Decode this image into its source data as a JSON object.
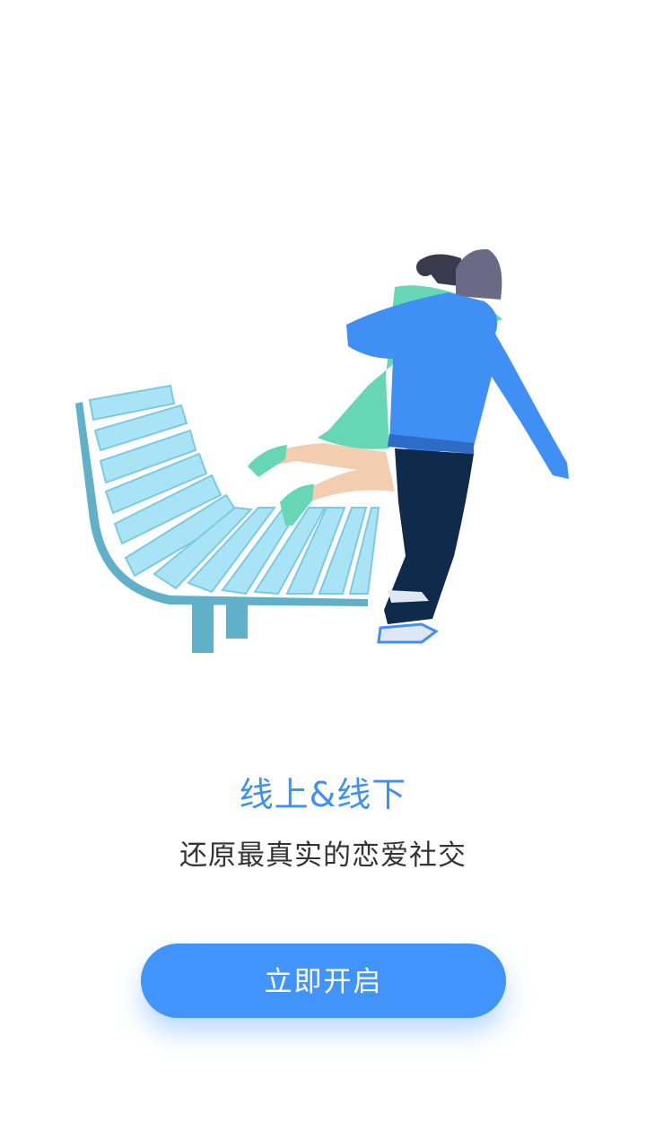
{
  "hero": {
    "illustration_icon": "couple-hug-on-bench-illustration"
  },
  "headline": "线上&线下",
  "subline": "还原最真实的恋爱社交",
  "cta": {
    "label": "立即开启"
  },
  "colors": {
    "accent": "#4194fb",
    "headline": "#3f8ff5",
    "subline": "#333333",
    "bench_light": "#a9e3f6",
    "bench_frame": "#5fb0c8",
    "jacket": "#3f8ff5",
    "jeans": "#0f2a4a",
    "dress": "#66d6b5",
    "hair": "#6a6a86"
  }
}
